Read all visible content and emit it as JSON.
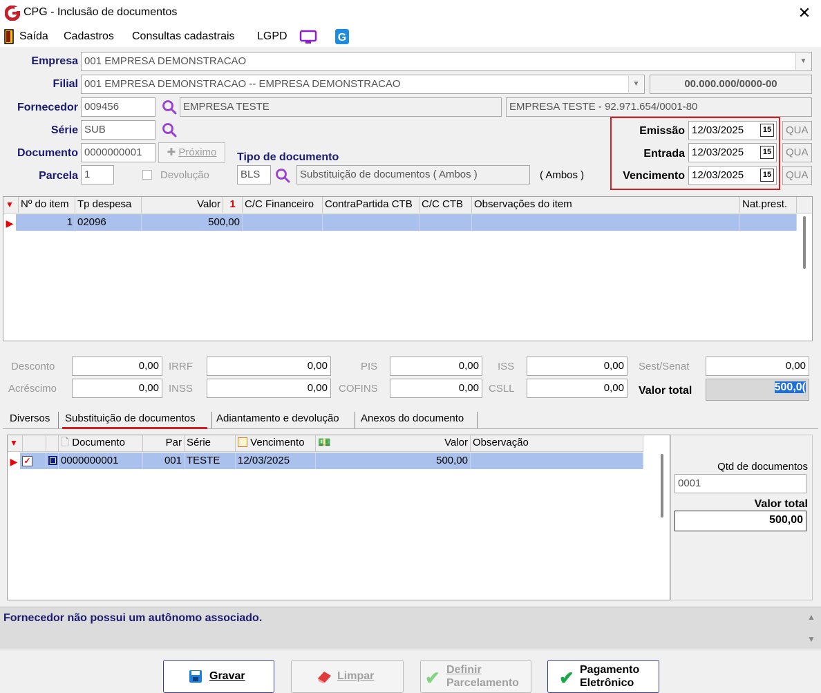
{
  "window": {
    "title": "CPG - Inclusão de documentos"
  },
  "menu": {
    "saida": "Saída",
    "cadastros": "Cadastros",
    "consultas": "Consultas cadastrais",
    "lgpd": "LGPD"
  },
  "form": {
    "empresa_label": "Empresa",
    "empresa_value": "001 EMPRESA DEMONSTRACAO",
    "filial_label": "Filial",
    "filial_value": "001 EMPRESA DEMONSTRACAO -- EMPRESA DEMONSTRACAO",
    "filial_cnpj": "00.000.000/0000-00",
    "fornecedor_label": "Fornecedor",
    "fornecedor_code": "009456",
    "fornecedor_name": "EMPRESA TESTE",
    "fornecedor_full": "EMPRESA TESTE - 92.971.654/0001-80",
    "serie_label": "Série",
    "serie_value": "SUB",
    "documento_label": "Documento",
    "documento_value": "0000000001",
    "proximo_label": "Próximo",
    "parcela_label": "Parcela",
    "parcela_value": "1",
    "devolucao_label": "Devolução",
    "tipo_doc_label": "Tipo de documento",
    "tipo_doc_code": "BLS",
    "tipo_doc_desc": "Substituição de documentos ( Ambos )",
    "tipo_doc_scope": "( Ambos )",
    "emissao_label": "Emissão",
    "emissao_value": "12/03/2025",
    "emissao_day": "QUA",
    "entrada_label": "Entrada",
    "entrada_value": "12/03/2025",
    "entrada_day": "QUA",
    "vencimento_label": "Vencimento",
    "vencimento_value": "12/03/2025",
    "vencimento_day": "QUA",
    "calendar_glyph": "15"
  },
  "items_grid": {
    "headers": [
      "Nº do item",
      "Tp despesa",
      "Valor",
      "C/C Financeiro",
      "ContraPartida CTB",
      "C/C CTB",
      "Observações do item",
      "Nat.prest."
    ],
    "sort_glyph": "1",
    "rows": [
      {
        "item": "1",
        "tp_despesa": "02096",
        "valor": "500,00"
      }
    ]
  },
  "totals": {
    "desconto_label": "Desconto",
    "desconto": "0,00",
    "irrf_label": "IRRF",
    "irrf": "0,00",
    "pis_label": "PIS",
    "pis": "0,00",
    "iss_label": "ISS",
    "iss": "0,00",
    "sest_label": "Sest/Senat",
    "sest": "0,00",
    "acrescimo_label": "Acréscimo",
    "acrescimo": "0,00",
    "inss_label": "INSS",
    "inss": "0,00",
    "cofins_label": "COFINS",
    "cofins": "0,00",
    "csll_label": "CSLL",
    "csll": "0,00",
    "valor_total_label": "Valor total",
    "valor_total": "500,0("
  },
  "tabs": [
    "Diversos",
    "Substituição de documentos",
    "Adiantamento e devolução",
    "Anexos do documento"
  ],
  "subst_grid": {
    "headers": [
      "Documento",
      "Par",
      "Série",
      "Vencimento",
      "Valor",
      "Observação"
    ],
    "rows": [
      {
        "documento": "0000000001",
        "par": "001",
        "serie": "TESTE",
        "vencimento": "12/03/2025",
        "valor": "500,00"
      }
    ]
  },
  "side_panel": {
    "qtd_label": "Qtd de documentos",
    "qtd_value": "0001",
    "valor_total_label": "Valor total",
    "valor_total": "500,00"
  },
  "status": {
    "message": "Fornecedor não possui um autônomo associado."
  },
  "buttons": {
    "gravar": "Gravar",
    "limpar": "Limpar",
    "definir_line1": "Definir",
    "definir_line2": "Parcelamento",
    "pagamento_line1": "Pagamento",
    "pagamento_line2": "Eletrônico"
  },
  "colors": {
    "accent": "#1a1a6e",
    "selection": "#a9c1ec",
    "highlight": "#d42222"
  }
}
